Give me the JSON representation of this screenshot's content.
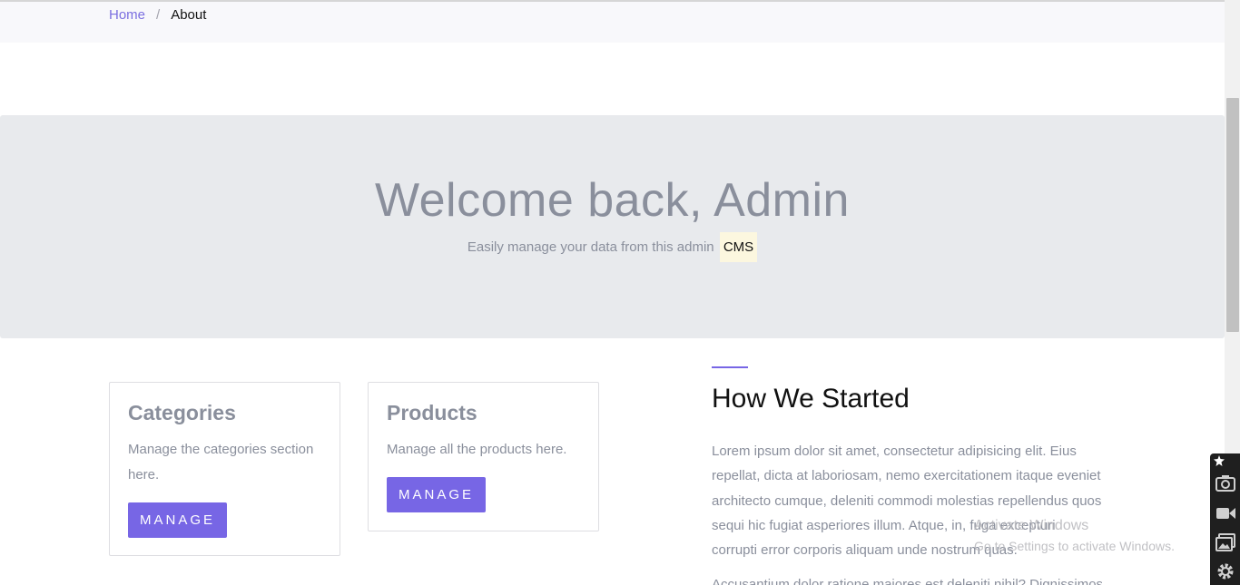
{
  "breadcrumb": {
    "home": "Home",
    "separator": "/",
    "current": "About"
  },
  "hero": {
    "title": "Welcome back, Admin",
    "subtitle": "Easily manage your data from this admin",
    "highlight": "CMS"
  },
  "cards": [
    {
      "title": "Categories",
      "text": "Manage the categories section here.",
      "button": "MANAGE"
    },
    {
      "title": "Products",
      "text": "Manage all the products here.",
      "button": "MANAGE"
    }
  ],
  "story": {
    "title": "How We Started",
    "body": "Lorem ipsum dolor sit amet, consectetur adipisicing elit. Eius repellat, dicta at laboriosam, nemo exercitationem itaque eveniet architecto cumque, deleniti commodi molestias repellendus quos sequi hic fugiat asperiores illum. Atque, in, fuga excepturi corrupti error corporis aliquam unde nostrum quas.",
    "body_2": "Accusantium dolor ratione maiores est deleniti nihil? Dignissimos"
  },
  "watermark": {
    "title": "Activate Windows",
    "subtitle": "Go to Settings to activate Windows."
  },
  "tools": [
    "camera-icon",
    "video-icon",
    "gallery-icon",
    "settings-icon"
  ],
  "colors": {
    "accent": "#7766e5",
    "hero_bg": "#e8eaed",
    "muted_text": "#8a8f9c"
  }
}
